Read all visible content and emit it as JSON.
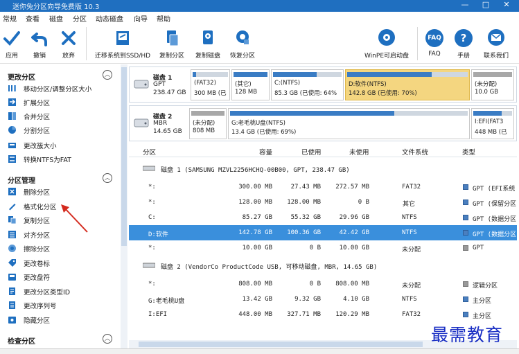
{
  "window": {
    "title": "迷你兔分区向导免费版 10.3",
    "minimize": "—",
    "maximize": "□",
    "close": "✕"
  },
  "menu": [
    "常规",
    "查看",
    "磁盘",
    "分区",
    "动态磁盘",
    "向导",
    "帮助"
  ],
  "toolbar": {
    "apply": "应用",
    "undo": "撤销",
    "discard": "放弃",
    "migrate": "迁移系统到SSD/HD",
    "copy_partition": "复制分区",
    "copy_disk": "复制磁盘",
    "recover": "恢复分区",
    "winpe": "WinPE可启动盘",
    "faq": "FAQ",
    "manual": "手册",
    "contact": "联系我们",
    "faq_badge": "FAQ",
    "manual_badge": "?"
  },
  "sidebar": {
    "sec1": "更改分区",
    "sec1_items": [
      "移动分区/调整分区大小",
      "扩展分区",
      "合并分区",
      "分割分区",
      "更改簇大小",
      "转换NTFS为FAT"
    ],
    "sec2": "分区管理",
    "sec2_items": [
      "删除分区",
      "格式化分区",
      "复制分区",
      "对齐分区",
      "擦除分区",
      "更改卷标",
      "更改盘符",
      "更改分区类型ID",
      "更改序列号",
      "隐藏分区"
    ],
    "sec3": "检查分区",
    "collapse_glyph": "︿"
  },
  "disks": [
    {
      "name": "磁盘 1",
      "type": "GPT",
      "size": "238.47 GB",
      "parts": [
        {
          "l1": "(FAT32)",
          "l2": "300 MB (已",
          "fill": 0.09,
          "sel": false
        },
        {
          "l1": "(其它)",
          "l2": "128 MB",
          "fill": 1.0,
          "sel": false
        },
        {
          "l1": "C:(NTFS)",
          "l2": "85.3 GB (已使用: 64%",
          "fill": 0.64,
          "sel": false
        },
        {
          "l1": "D:软件(NTFS)",
          "l2": "142.8 GB (已使用: 70%)",
          "fill": 0.7,
          "sel": true
        },
        {
          "l1": "(未分配)",
          "l2": "10.0 GB",
          "fill": 0.0,
          "sel": false
        }
      ]
    },
    {
      "name": "磁盘 2",
      "type": "MBR",
      "size": "14.65 GB",
      "parts": [
        {
          "l1": "(未分配)",
          "l2": "808 MB",
          "fill": 0.0,
          "sel": false
        },
        {
          "l1": "G:老毛桃U盘(NTFS)",
          "l2": "13.4 GB (已使用: 69%)",
          "fill": 0.69,
          "sel": false
        },
        {
          "l1": "I:EFI(FAT3",
          "l2": "448 MB (已",
          "fill": 0.73,
          "sel": false
        }
      ]
    }
  ],
  "table": {
    "headers": [
      "分区",
      "容量",
      "已使用",
      "未使用",
      "文件系统",
      "类型"
    ],
    "disk1_header": "磁盘 1 (SAMSUNG MZVL2256HCHQ-00B00, GPT, 238.47 GB)",
    "disk2_header": "磁盘 2 (VendorCo ProductCode USB, 可移动磁盘, MBR, 14.65 GB)",
    "disk1_rows": [
      [
        "*:",
        "300.00 MB",
        "27.43 MB",
        "272.57 MB",
        "FAT32",
        "GPT (EFI系统"
      ],
      [
        "*:",
        "128.00 MB",
        "128.00 MB",
        "0 B",
        "其它",
        "GPT (保留分区"
      ],
      [
        "C:",
        "85.27 GB",
        "55.32 GB",
        "29.96 GB",
        "NTFS",
        "GPT (数据分区"
      ],
      [
        "D:软件",
        "142.78 GB",
        "100.36 GB",
        "42.42 GB",
        "NTFS",
        "GPT (数据分区"
      ],
      [
        "*:",
        "10.00 GB",
        "0 B",
        "10.00 GB",
        "未分配",
        "GPT"
      ]
    ],
    "disk2_rows": [
      [
        "*:",
        "808.00 MB",
        "0 B",
        "808.00 MB",
        "未分配",
        "逻辑分区"
      ],
      [
        "G:老毛桃U盘",
        "13.42 GB",
        "9.32 GB",
        "4.10 GB",
        "NTFS",
        "主分区"
      ],
      [
        "I:EFI",
        "448.00 MB",
        "327.71 MB",
        "120.29 MB",
        "FAT32",
        "主分区"
      ]
    ]
  },
  "watermark": "最需教育",
  "colors": {
    "accent": "#1e6fc0",
    "selected_row": "#3a8fdc",
    "selected_part": "#f4d680",
    "used_fill": "#3a7cc4"
  }
}
